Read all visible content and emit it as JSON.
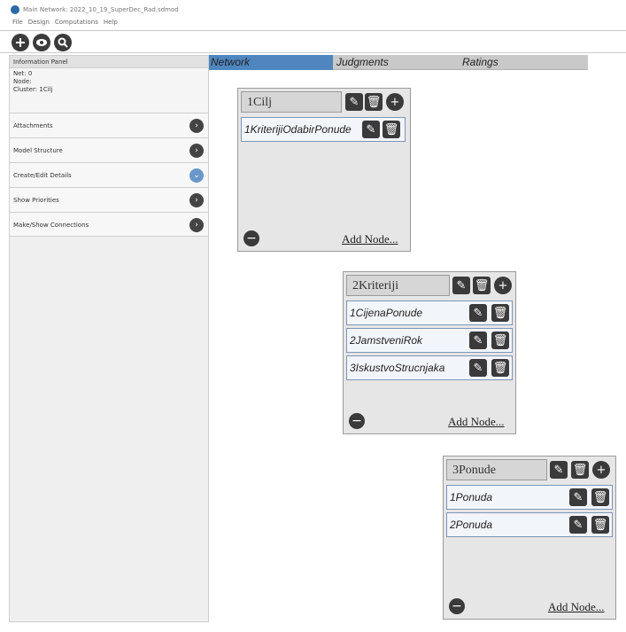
{
  "window": {
    "title": "Main Network: 2022_10_19_SuperDec_Rad.sdmod"
  },
  "menu": [
    "File",
    "Design",
    "Computations",
    "Help"
  ],
  "info_panel": {
    "title": "Information Panel",
    "net": "Net: 0",
    "node": "Node:",
    "cluster": "Cluster: 1Cilj"
  },
  "sidebar_items": [
    {
      "label": "Attachments",
      "icon": "chevron-right-icon"
    },
    {
      "label": "Model Structure",
      "icon": "chevron-right-icon"
    },
    {
      "label": "Create/Edit Details",
      "icon": "chevron-down-icon"
    },
    {
      "label": "Show Priorities",
      "icon": "chevron-right-icon"
    },
    {
      "label": "Make/Show Connections",
      "icon": "chevron-right-icon"
    }
  ],
  "tabs": [
    "Network",
    "Judgments",
    "Ratings"
  ],
  "clusters": [
    {
      "name": "1Cilj",
      "nodes": [
        "1KriterijiOdabirPonude"
      ],
      "add_label": "Add Node..."
    },
    {
      "name": "2Kriteriji",
      "nodes": [
        "1CijenaPonude",
        "2JamstveniRok",
        "3IskustvoStrucnjaka"
      ],
      "add_label": "Add Node..."
    },
    {
      "name": "3Ponude",
      "nodes": [
        "1Ponuda",
        "2Ponuda"
      ],
      "add_label": "Add Node..."
    }
  ],
  "colors": {
    "active_tab": "#4f86bf",
    "node_border": "#7d96b5",
    "button": "#3a3a3a"
  }
}
